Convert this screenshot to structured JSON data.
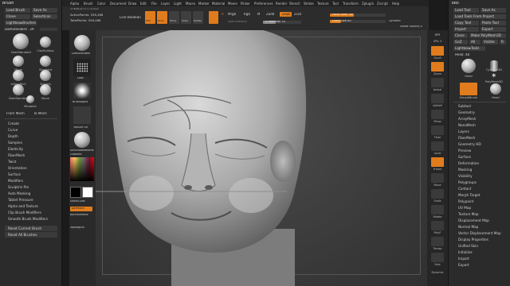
{
  "brush_panel": {
    "title": "Brush",
    "buttons": [
      "Load Brush",
      "Save As",
      "Clone",
      "SelectIcon",
      "Lightbox▸Brushes"
    ],
    "current": "DamStandard . 29",
    "brushes": [
      "DamStandard",
      "ClayBuildup",
      "Move",
      "Standard",
      "SelectRect",
      "Smooth",
      "DamStandard",
      "Move",
      "Mbubble"
    ],
    "from_mesh": "From Mesh",
    "to_mesh": "To Mesh",
    "menu": [
      "Create",
      "Curve",
      "Depth",
      "Samples",
      "Elasticity",
      "FiberMesh",
      "Twist",
      "Orientation",
      "Surface",
      "Modifiers",
      "Sculptris Pro",
      "Auto Masking",
      "Tablet Pressure",
      "Alpha and Texture",
      "Clip Brush Modifiers",
      "Smooth Brush Modifiers"
    ],
    "reset_current": "Reset Current Brush",
    "reset_all": "Reset All Brushes"
  },
  "menubar": [
    "Alpha",
    "Brush",
    "Color",
    "Document",
    "Draw",
    "Edit",
    "File",
    "Layer",
    "Light",
    "Macro",
    "Marker",
    "Material",
    "Movie",
    "Picker",
    "Preferences",
    "Render",
    "Stencil",
    "Stroke",
    "Texture",
    "Tool",
    "Transform",
    "Zplugin",
    "Zscript",
    "Help"
  ],
  "info": {
    "coords": "-0.618,0.177,-0.512",
    "active_points": "ActivePoints: 556,468",
    "total_points": "TotalPoints: 556,468",
    "live_boolean": "Live Boolean"
  },
  "top_shelf": {
    "buttons": [
      "Edit",
      "Draw",
      "Move",
      "Scale",
      "Rotate"
    ],
    "a_label": "A",
    "mrgb": "Mrgb",
    "rgb": "Rgb",
    "m": "M",
    "zadd": "Zadd",
    "zsub": "Zsub",
    "zcut": "Zcut",
    "rgb_intensity": "Rgb Intensity",
    "z_intensity": "Z Intensity 33",
    "focal_shift": "Focal Shift -16",
    "draw_size": "Draw Size 40",
    "dynamic": "Dynamic",
    "shade_opacity": "Shade Opacity 0"
  },
  "left_tray": {
    "items": [
      "DamStandard",
      "Dots",
      "BrushAlpha",
      "Texture Off",
      "SkinShadeMaterial"
    ],
    "gradient": "Gradient",
    "switch_color": "SwitchColor",
    "alternate": "Alternate",
    "backface_mask": "BackfaceMask",
    "topological": "Topological"
  },
  "right_tray": [
    "BPR",
    "SPix 3",
    "Scroll",
    "Zoom",
    "Actual",
    "AAHalf",
    "Persp",
    "Floor",
    "Local",
    "Frame",
    "Move",
    "Scale",
    "Rotate",
    "PolyF",
    "Transp",
    "Solo",
    "Dynamic"
  ],
  "tool_panel": {
    "title": "Tool",
    "buttons": [
      "Load Tool",
      "Save As",
      "Load Tools From Project",
      "Copy Tool",
      "Paste Tool",
      "Import",
      "Export",
      "Clone",
      "Make PolyMesh3D",
      "GoZ",
      "All",
      "Visible",
      "R",
      "Lightbox▸Tools"
    ],
    "current": "Head. 48",
    "tools": [
      "Head",
      "Cylinder3D",
      "PolyMesh3D",
      "SimpleBrush",
      "Head"
    ],
    "menu": [
      "Subtool",
      "Geometry",
      "ArrayMesh",
      "NanoMesh",
      "Layers",
      "FiberMesh",
      "Geometry HD",
      "Preview",
      "Surface",
      "Deformation",
      "Masking",
      "Visibility",
      "Polygroups",
      "Contact",
      "Morph Target",
      "Polypaint",
      "UV Map",
      "Texture Map",
      "Displacement Map",
      "Normal Map",
      "Vector Displacement Map",
      "Display Properties",
      "Unified Skin",
      "Initialize",
      "Import",
      "Export"
    ]
  },
  "colors": {
    "accent": "#e07c1d",
    "panel": "#2b2b2b",
    "canvas": "#3a3a3a"
  }
}
